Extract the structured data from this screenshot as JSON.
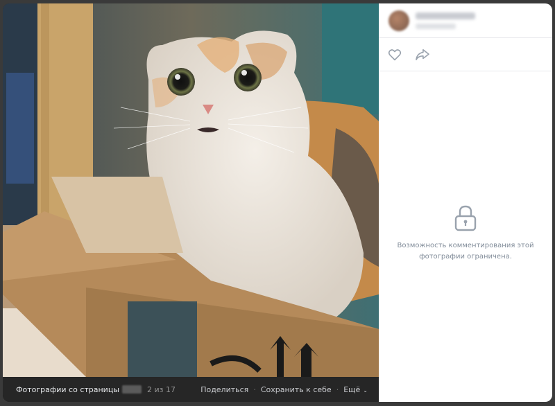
{
  "viewer": {
    "album_label": "Фотографии со страницы",
    "counter": "2 из 17",
    "share_label": "Поделиться",
    "save_label": "Сохранить к себе",
    "more_label": "Ещё"
  },
  "side_panel": {
    "comments_locked_text": "Возможность комментирования этой фотографии ограничена."
  },
  "icons": {
    "like": "heart-icon",
    "share": "share-arrow-icon",
    "lock": "lock-icon",
    "more_chevron": "chevron-down-icon"
  },
  "colors": {
    "panel_bg": "#ffffff",
    "bar_bg": "#262626",
    "icon_gray": "#99a2ad",
    "muted_text": "#818c99"
  }
}
